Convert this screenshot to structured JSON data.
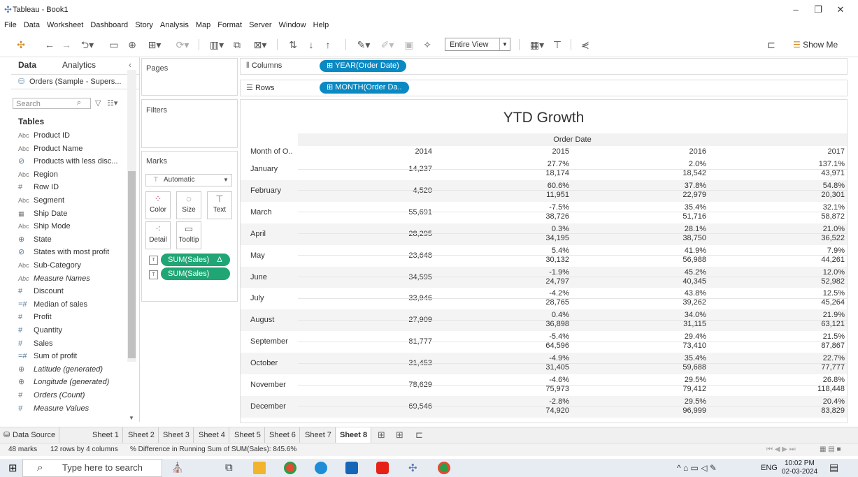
{
  "window": {
    "title": "Tableau - Book1",
    "minimize": "–",
    "restore": "❐",
    "close": "✕"
  },
  "menu": [
    "File",
    "Data",
    "Worksheet",
    "Dashboard",
    "Story",
    "Analysis",
    "Map",
    "Format",
    "Server",
    "Window",
    "Help"
  ],
  "toolbar": {
    "fit_value": "Entire View",
    "show_me": "Show Me"
  },
  "data_pane": {
    "tabs": {
      "data": "Data",
      "analytics": "Analytics"
    },
    "datasource": "Orders (Sample - Supers...",
    "search_placeholder": "Search",
    "tables_label": "Tables",
    "fields": [
      {
        "type": "Abc",
        "name": "Product ID",
        "italic": false
      },
      {
        "type": "Abc",
        "name": "Product Name",
        "italic": false
      },
      {
        "type": "set",
        "name": "Products with less disc...",
        "italic": false
      },
      {
        "type": "Abc",
        "name": "Region",
        "italic": false
      },
      {
        "type": "#",
        "name": "Row ID",
        "italic": false
      },
      {
        "type": "Abc",
        "name": "Segment",
        "italic": false
      },
      {
        "type": "date",
        "name": "Ship Date",
        "italic": false
      },
      {
        "type": "Abc",
        "name": "Ship Mode",
        "italic": false
      },
      {
        "type": "geo",
        "name": "State",
        "italic": false
      },
      {
        "type": "set",
        "name": "States with most profit",
        "italic": false
      },
      {
        "type": "Abc",
        "name": "Sub-Category",
        "italic": false
      },
      {
        "type": "Abc",
        "name": "Measure Names",
        "italic": true
      },
      {
        "type": "#",
        "name": "Discount",
        "italic": false
      },
      {
        "type": "=#",
        "name": "Median of sales",
        "italic": false
      },
      {
        "type": "#",
        "name": "Profit",
        "italic": false
      },
      {
        "type": "#",
        "name": "Quantity",
        "italic": false
      },
      {
        "type": "#",
        "name": "Sales",
        "italic": false
      },
      {
        "type": "=#",
        "name": "Sum of profit",
        "italic": false
      },
      {
        "type": "geo",
        "name": "Latitude (generated)",
        "italic": true
      },
      {
        "type": "geo",
        "name": "Longitude (generated)",
        "italic": true
      },
      {
        "type": "#",
        "name": "Orders (Count)",
        "italic": true
      },
      {
        "type": "#",
        "name": "Measure Values",
        "italic": true
      }
    ]
  },
  "cards": {
    "pages": "Pages",
    "filters": "Filters",
    "marks": "Marks",
    "mark_type": "Automatic",
    "mark_buttons": {
      "color": "Color",
      "size": "Size",
      "text": "Text",
      "detail": "Detail",
      "tooltip": "Tooltip"
    },
    "pill1": "SUM(Sales)",
    "pill1_delta": "Δ",
    "pill2": "SUM(Sales)"
  },
  "shelves": {
    "columns_label": "Columns",
    "columns_pill": "YEAR(Order Date)",
    "rows_label": "Rows",
    "rows_pill": "MONTH(Order Da.."
  },
  "view": {
    "title": "YTD Growth",
    "column_group": "Order Date",
    "row_header": "Month of O..",
    "years": [
      "2014",
      "2015",
      "2016",
      "2017"
    ],
    "rows": [
      {
        "month": "January",
        "v2014": "14,237",
        "p2015": "27.7%",
        "v2015": "18,174",
        "p2016": "2.0%",
        "v2016": "18,542",
        "p2017": "137.1%",
        "v2017": "43,971"
      },
      {
        "month": "February",
        "v2014": "4,520",
        "p2015": "60.6%",
        "v2015": "11,951",
        "p2016": "37.8%",
        "v2016": "22,979",
        "p2017": "54.8%",
        "v2017": "20,301"
      },
      {
        "month": "March",
        "v2014": "55,691",
        "p2015": "-7.5%",
        "v2015": "38,726",
        "p2016": "35.4%",
        "v2016": "51,716",
        "p2017": "32.1%",
        "v2017": "58,872"
      },
      {
        "month": "April",
        "v2014": "28,295",
        "p2015": "0.3%",
        "v2015": "34,195",
        "p2016": "28.1%",
        "v2016": "38,750",
        "p2017": "21.0%",
        "v2017": "36,522"
      },
      {
        "month": "May",
        "v2014": "23,648",
        "p2015": "5.4%",
        "v2015": "30,132",
        "p2016": "41.9%",
        "v2016": "56,988",
        "p2017": "7.9%",
        "v2017": "44,261"
      },
      {
        "month": "June",
        "v2014": "34,595",
        "p2015": "-1.9%",
        "v2015": "24,797",
        "p2016": "45.2%",
        "v2016": "40,345",
        "p2017": "12.0%",
        "v2017": "52,982"
      },
      {
        "month": "July",
        "v2014": "33,946",
        "p2015": "-4.2%",
        "v2015": "28,765",
        "p2016": "43.8%",
        "v2016": "39,262",
        "p2017": "12.5%",
        "v2017": "45,264"
      },
      {
        "month": "August",
        "v2014": "27,909",
        "p2015": "0.4%",
        "v2015": "36,898",
        "p2016": "34.0%",
        "v2016": "31,115",
        "p2017": "21.9%",
        "v2017": "63,121"
      },
      {
        "month": "September",
        "v2014": "81,777",
        "p2015": "-5.4%",
        "v2015": "64,596",
        "p2016": "29.4%",
        "v2016": "73,410",
        "p2017": "21.5%",
        "v2017": "87,867"
      },
      {
        "month": "October",
        "v2014": "31,453",
        "p2015": "-4.9%",
        "v2015": "31,405",
        "p2016": "35.4%",
        "v2016": "59,688",
        "p2017": "22.7%",
        "v2017": "77,777"
      },
      {
        "month": "November",
        "v2014": "78,629",
        "p2015": "-4.6%",
        "v2015": "75,973",
        "p2016": "29.5%",
        "v2016": "79,412",
        "p2017": "26.8%",
        "v2017": "118,448"
      },
      {
        "month": "December",
        "v2014": "69,546",
        "p2015": "-2.8%",
        "v2015": "74,920",
        "p2016": "29.5%",
        "v2016": "96,999",
        "p2017": "20.4%",
        "v2017": "83,829"
      }
    ]
  },
  "sheet_tabs": {
    "data_source": "Data Source",
    "sheets": [
      "Sheet 1",
      "Sheet 2",
      "Sheet 3",
      "Sheet 4",
      "Sheet 5",
      "Sheet 6",
      "Sheet 7",
      "Sheet 8"
    ],
    "active": "Sheet 8"
  },
  "status": {
    "marks": "48 marks",
    "dims": "12 rows by 4 columns",
    "summary": "% Difference in Running Sum of SUM(Sales): 845.6%"
  },
  "taskbar": {
    "search_placeholder": "Type here to search",
    "lang": "ENG",
    "time": "10:02 PM",
    "date": "02-03-2024"
  },
  "colors": {
    "green_pill": "#20a574",
    "blue_pill": "#0a89c3"
  }
}
